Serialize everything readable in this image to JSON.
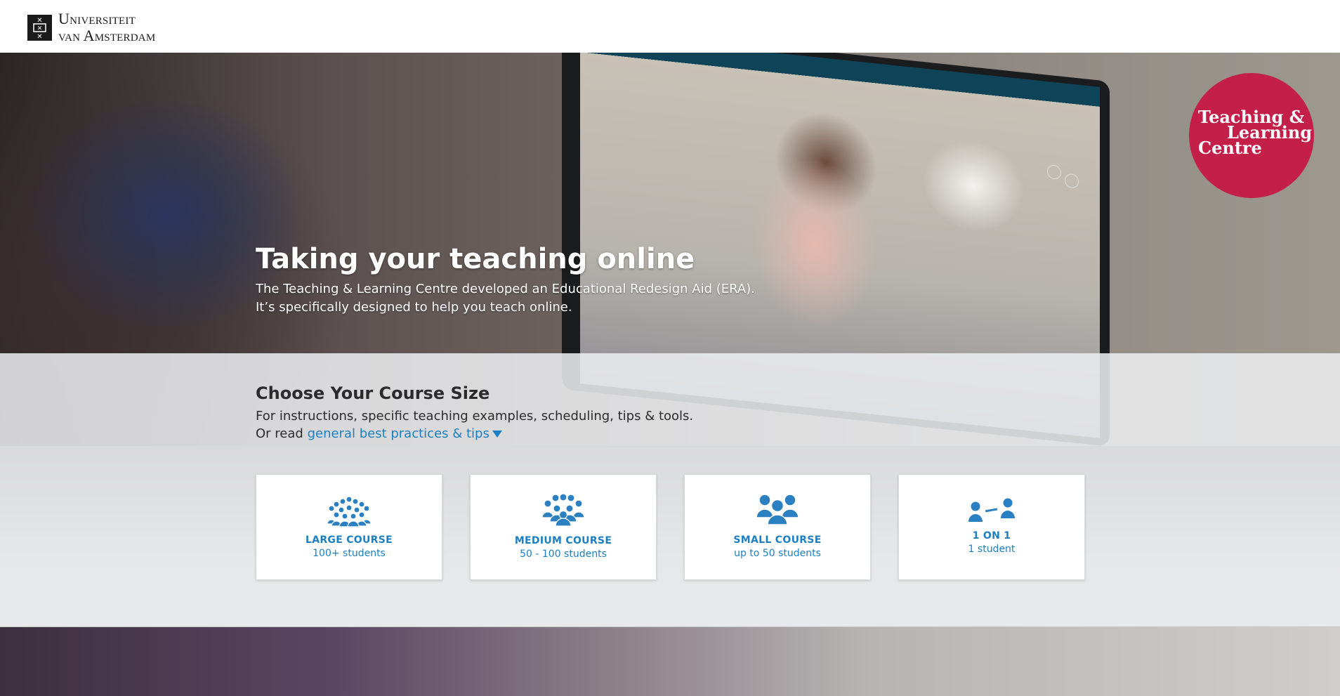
{
  "header": {
    "logo_line1": "Universiteit",
    "logo_line2": "van Amsterdam"
  },
  "badge": {
    "line1": "Teaching &",
    "line2": "Learning",
    "line3": "Centre",
    "color": "#c31f48"
  },
  "hero": {
    "title": "Taking your teaching online",
    "subtitle_line1": "The Teaching & Learning Centre developed an Educational Redesign Aid (ERA).",
    "subtitle_line2": "It’s specifically designed to help you teach online."
  },
  "course_section": {
    "title": "Choose Your Course Size",
    "description": "For instructions, specific teaching examples, scheduling, tips & tools.",
    "or_read": "Or read",
    "link_text": "general best practices & tips",
    "cards": [
      {
        "title": "LARGE COURSE",
        "subtitle": "100+ students",
        "icon": "large-group-icon"
      },
      {
        "title": "MEDIUM COURSE",
        "subtitle": "50 - 100 students",
        "icon": "medium-group-icon"
      },
      {
        "title": "SMALL COURSE",
        "subtitle": "up to 50 students",
        "icon": "small-group-icon"
      },
      {
        "title": "1 ON 1",
        "subtitle": "1 student",
        "icon": "one-on-one-icon"
      }
    ]
  },
  "colors": {
    "accent": "#1b7fc2",
    "badge": "#c31f48",
    "text": "#2b2b2b"
  }
}
